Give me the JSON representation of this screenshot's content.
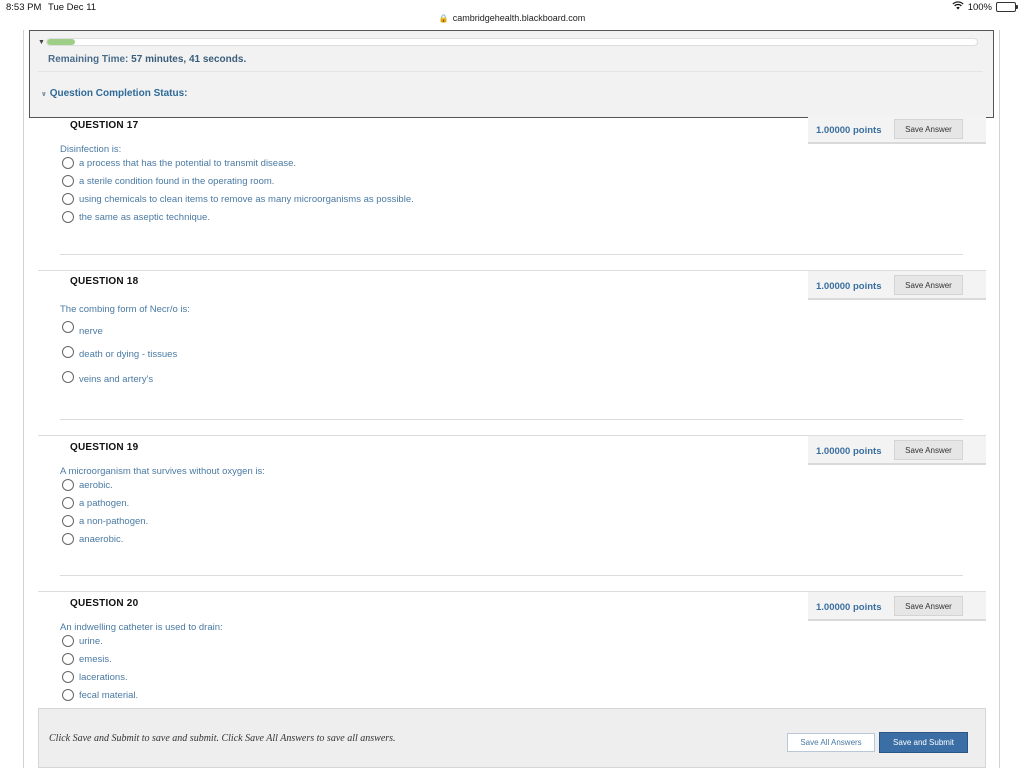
{
  "status_bar": {
    "time": "8:53 PM",
    "date": "Tue Dec 11",
    "battery": "100%"
  },
  "browser": {
    "url": "cambridgehealth.blackboard.com"
  },
  "timer": {
    "remaining_label": "Remaining Time:",
    "remaining_value": "57 minutes, 41 seconds.",
    "completion_label": "Question Completion Status:",
    "progress_fraction": 0.03
  },
  "questions": [
    {
      "title": "QUESTION 17",
      "points": "1.00000 points",
      "save_label": "Save Answer",
      "prompt": "Disinfection is:",
      "options": [
        "a process that has the potential to transmit disease.",
        "a sterile condition found in the operating room.",
        "using chemicals to clean items to remove as many microorganisms as possible.",
        "the same as aseptic technique."
      ]
    },
    {
      "title": "QUESTION 18",
      "points": "1.00000 points",
      "save_label": "Save Answer",
      "prompt": "The combing form of Necr/o  is:",
      "options": [
        "nerve",
        "death or dying - tissues",
        "veins and artery's"
      ]
    },
    {
      "title": "QUESTION 19",
      "points": "1.00000 points",
      "save_label": "Save Answer",
      "prompt": "A microorganism that survives without oxygen is:",
      "options": [
        "aerobic.",
        "a pathogen.",
        "a non-pathogen.",
        "anaerobic."
      ]
    },
    {
      "title": "QUESTION 20",
      "points": "1.00000 points",
      "save_label": "Save Answer",
      "prompt": "An indwelling catheter is used to drain:",
      "options": [
        "urine.",
        "emesis.",
        "lacerations.",
        "fecal material."
      ]
    }
  ],
  "footer": {
    "note": "Click Save and Submit to save and submit. Click Save All Answers to save all answers.",
    "save_all_label": "Save All Answers",
    "submit_label": "Save and Submit"
  }
}
